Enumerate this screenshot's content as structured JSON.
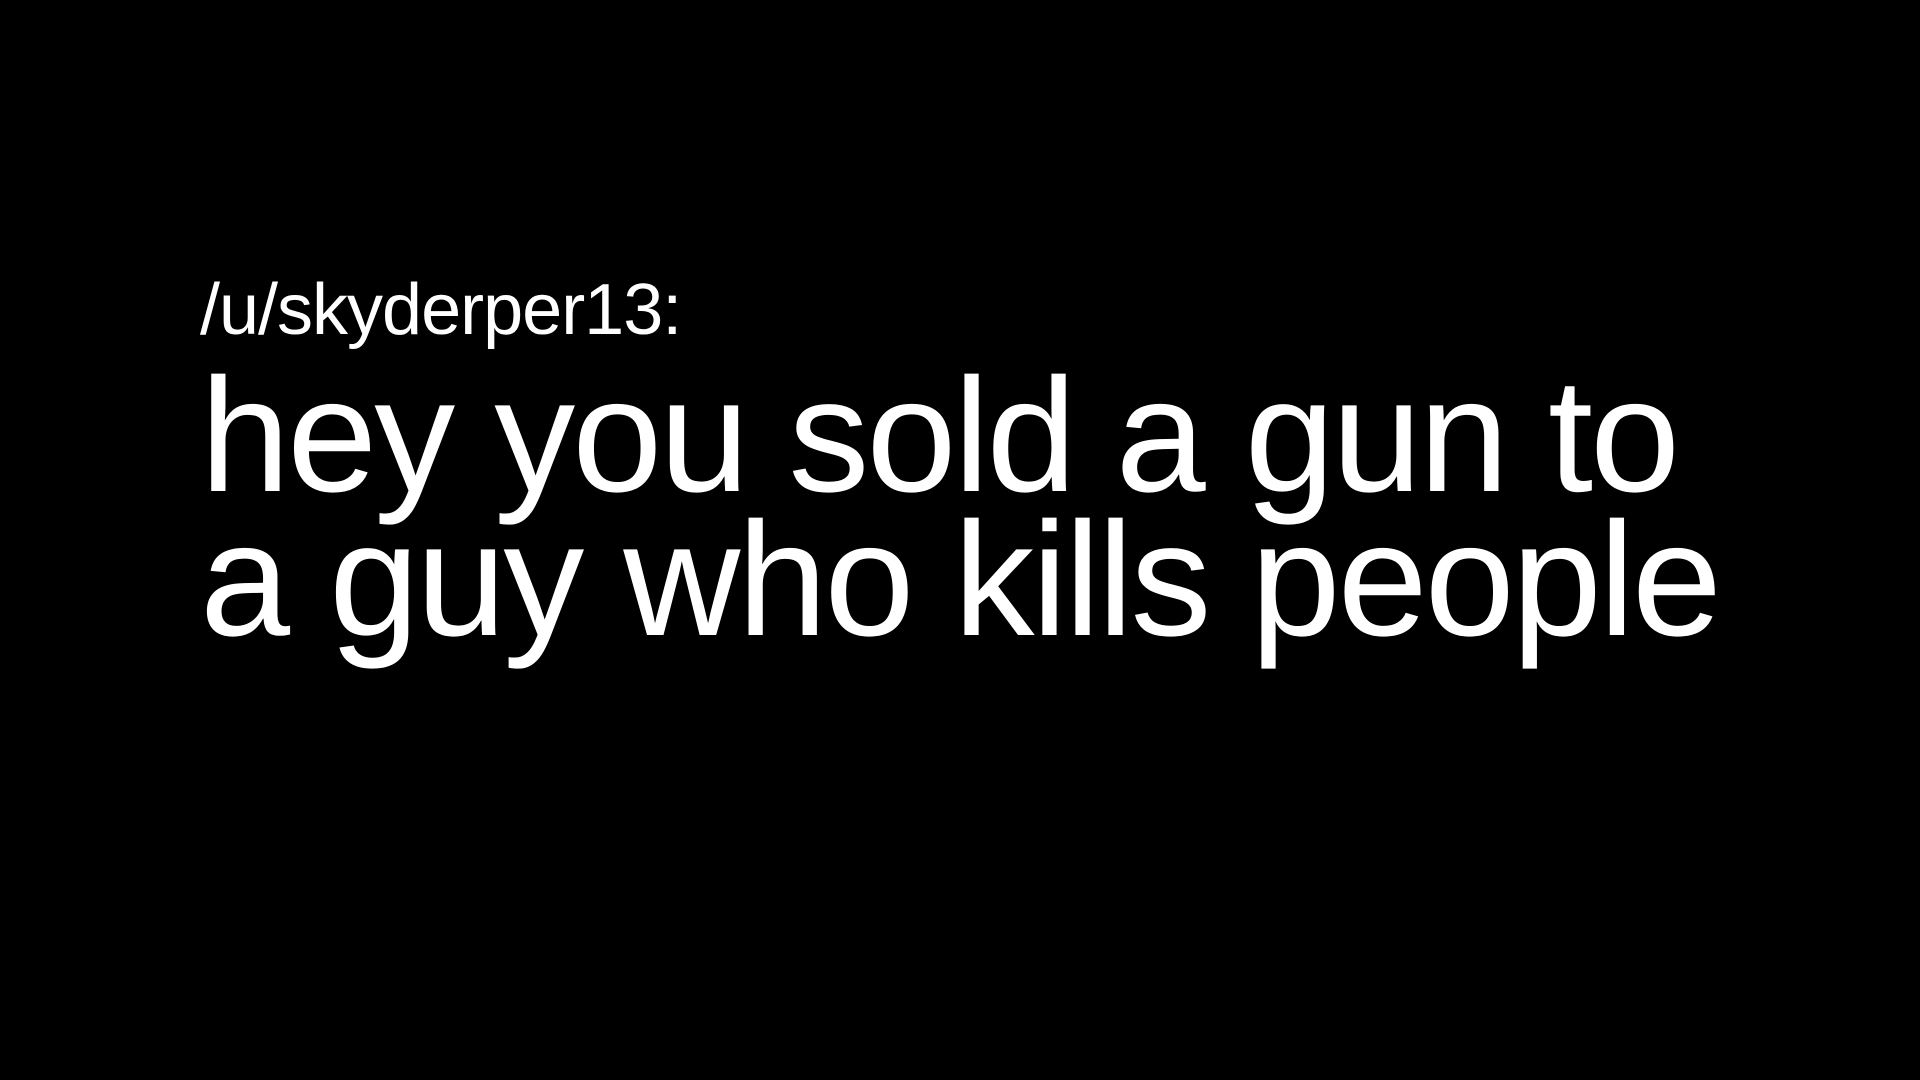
{
  "slide": {
    "username": "/u/skyderper13:",
    "quote_lines": [
      "hey you sold a gun to",
      "a guy who kills people"
    ],
    "colors": {
      "background": "#000000",
      "text": "#ffffff"
    }
  }
}
